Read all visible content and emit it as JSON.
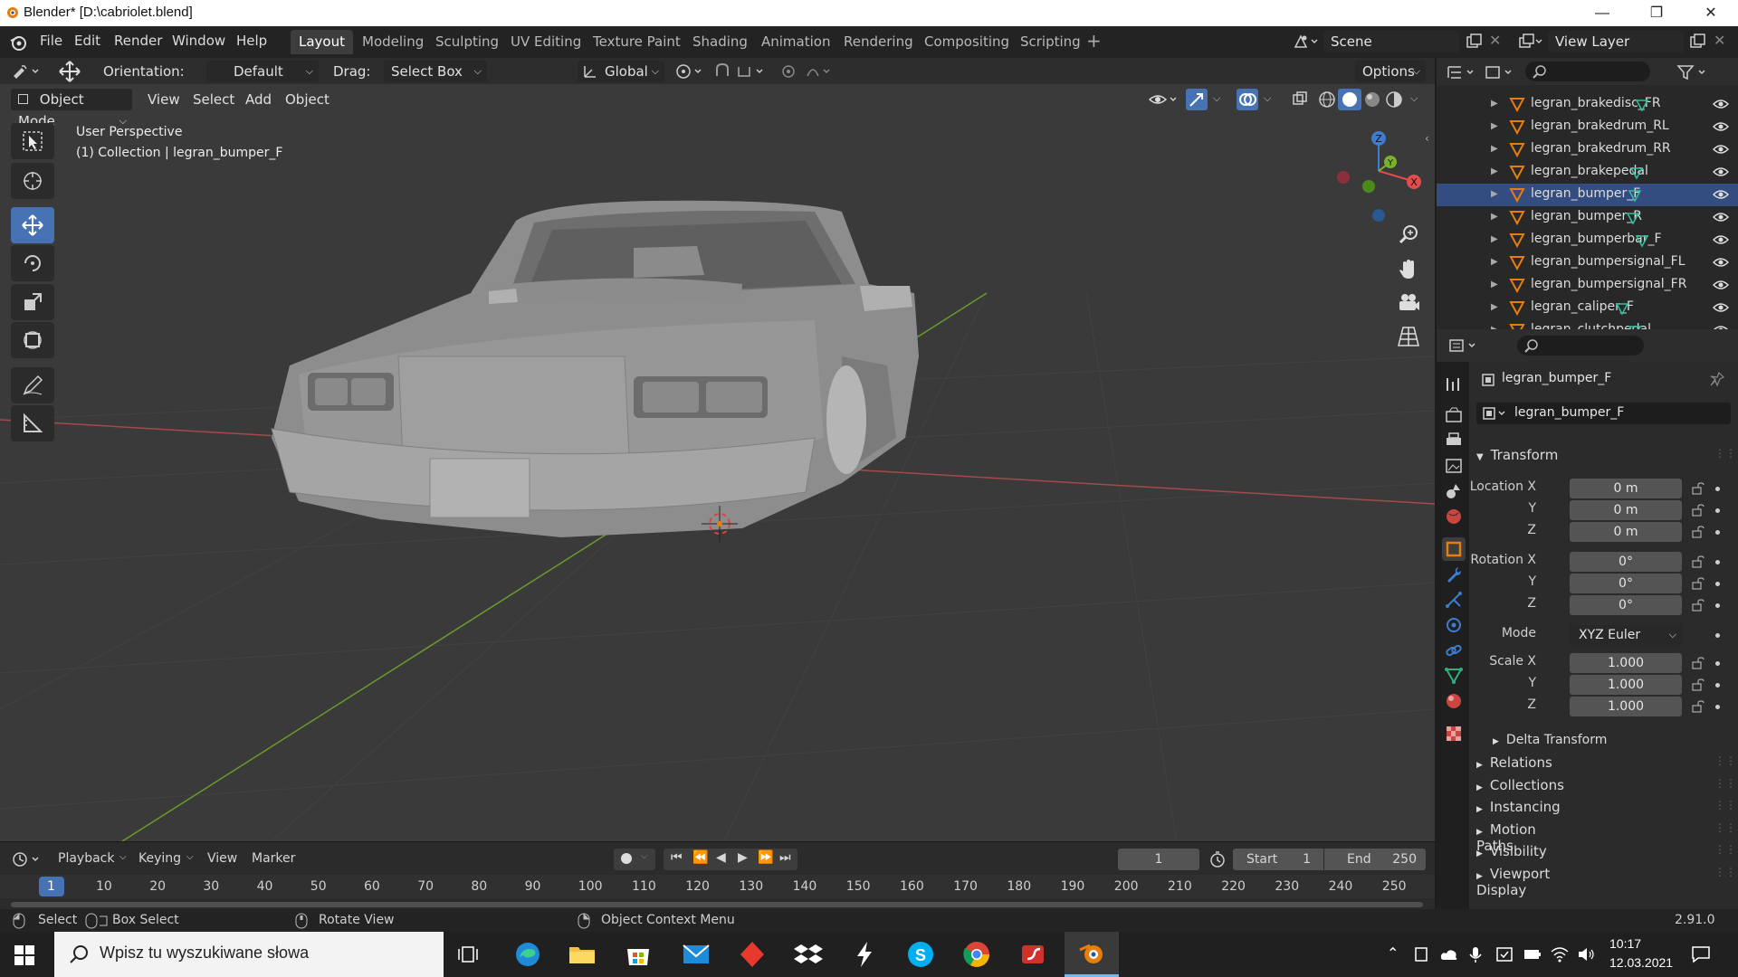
{
  "window": {
    "title": "Blender* [D:\\cabriolet.blend]"
  },
  "menu": [
    "File",
    "Edit",
    "Render",
    "Window",
    "Help"
  ],
  "workspaces": [
    "Layout",
    "Modeling",
    "Sculpting",
    "UV Editing",
    "Texture Paint",
    "Shading",
    "Animation",
    "Rendering",
    "Compositing",
    "Scripting"
  ],
  "active_workspace": "Layout",
  "scene": {
    "name": "Scene",
    "view_layer": "View Layer"
  },
  "tool_header": {
    "orientation_label": "Orientation:",
    "orientation_value": "Default",
    "drag_label": "Drag:",
    "drag_value": "Select Box",
    "transform_orientation": "Global",
    "options": "Options"
  },
  "viewport_header": {
    "mode": "Object Mode",
    "menus": [
      "View",
      "Select",
      "Add",
      "Object"
    ]
  },
  "viewport": {
    "perspective": "User Perspective",
    "collection_info": "(1) Collection | legran_bumper_F",
    "gizmo": {
      "x": "X",
      "y": "Y",
      "z": "Z"
    },
    "grid_colors": {
      "x_axis": "#a34a4a",
      "y_axis": "#6b9a2c"
    }
  },
  "outliner": {
    "rows": [
      {
        "name": "legran_brakedisc_FR",
        "selected": false
      },
      {
        "name": "legran_brakedrum_RL",
        "selected": false
      },
      {
        "name": "legran_brakedrum_RR",
        "selected": false
      },
      {
        "name": "legran_brakepedal",
        "selected": false
      },
      {
        "name": "legran_bumper_F",
        "selected": true
      },
      {
        "name": "legran_bumper_R",
        "selected": false
      },
      {
        "name": "legran_bumperbar_F",
        "selected": false
      },
      {
        "name": "legran_bumpersignal_FL",
        "selected": false
      },
      {
        "name": "legran_bumpersignal_FR",
        "selected": false
      },
      {
        "name": "legran_caliper_F",
        "selected": false
      },
      {
        "name": "legran_clutchpedal",
        "selected": false
      }
    ]
  },
  "properties": {
    "object_name": "legran_bumper_F",
    "object_field": "legran_bumper_F",
    "transform_title": "Transform",
    "location_label": "Location X",
    "location": [
      "0 m",
      "0 m",
      "0 m"
    ],
    "rotation_label": "Rotation X",
    "rotation": [
      "0°",
      "0°",
      "0°"
    ],
    "mode_label": "Mode",
    "mode_value": "XYZ Euler",
    "scale_label": "Scale X",
    "scale": [
      "1.000",
      "1.000",
      "1.000"
    ],
    "axis_y": "Y",
    "axis_z": "Z",
    "delta_transform": "Delta Transform",
    "sections": [
      "Relations",
      "Collections",
      "Instancing",
      "Motion Paths",
      "Visibility",
      "Viewport Display"
    ]
  },
  "timeline": {
    "menus": [
      "Playback",
      "Keying",
      "View",
      "Marker"
    ],
    "current_frame": "1",
    "start_label": "Start",
    "start": "1",
    "end_label": "End",
    "end": "250",
    "ruler": [
      "1",
      "10",
      "20",
      "30",
      "40",
      "50",
      "60",
      "70",
      "80",
      "90",
      "100",
      "110",
      "120",
      "130",
      "140",
      "150",
      "160",
      "170",
      "180",
      "190",
      "200",
      "210",
      "220",
      "230",
      "240",
      "250"
    ]
  },
  "status": {
    "select": "Select",
    "box_select": "Box Select",
    "rotate_view": "Rotate View",
    "context_menu": "Object Context Menu",
    "version": "2.91.0"
  },
  "taskbar": {
    "search_placeholder": "Wpisz tu wyszukiwane słowa",
    "time": "10:17",
    "date": "12.03.2021"
  },
  "colors": {
    "accent": "#4772b3",
    "orange": "#e87d0d",
    "selection": "#334d80"
  }
}
